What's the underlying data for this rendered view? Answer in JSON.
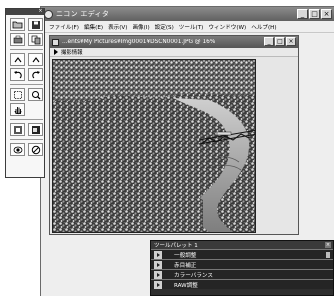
{
  "app": {
    "title": "ニコン エディタ"
  },
  "window_controls": {
    "minimize": "_",
    "maximize": "□",
    "close": "×"
  },
  "menu": [
    "ファイル(F)",
    "編集(E)",
    "表示(V)",
    "画像(I)",
    "設定(S)",
    "ツール(T)",
    "ウィンドウ(W)",
    "ヘルプ(H)"
  ],
  "document": {
    "title": "...ents¥My Pictures¥Img0001¥DSCN0001.JPG @ 16%",
    "info_label": "撮影情報",
    "photo_alt": "photo-river-bridge"
  },
  "toolbox": {
    "close": "×",
    "tools": [
      "open-folder-icon",
      "save-icon",
      "print-icon",
      "copy-icon",
      "rotate-left-icon",
      "rotate-right-icon",
      "undo-icon",
      "redo-icon",
      "select-crop-icon",
      "zoom-icon",
      "hand-icon",
      "fit-icon",
      "fullscreen-icon",
      "eye-icon",
      "cancel-icon"
    ]
  },
  "tool_palette": {
    "title": "ツールパレット 1",
    "close": "×",
    "sections": [
      "一般調整",
      "赤目補正",
      "カラーバランス",
      "RAW調整"
    ]
  },
  "colors": {
    "titlebar": "#606060",
    "palette_bg": "#252525"
  }
}
